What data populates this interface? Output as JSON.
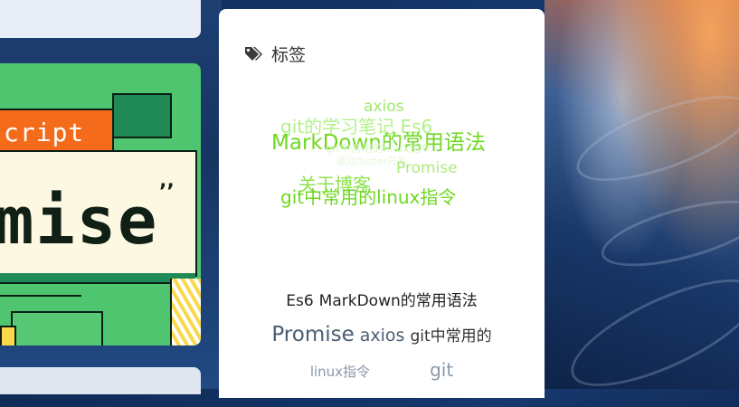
{
  "thumbnail": {
    "badge_text": "cript",
    "title_text": "mise",
    "title_mark": "’’"
  },
  "tag_panel": {
    "title": "标签",
    "icon": "tags-icon",
    "cloud_words": [
      {
        "text": "axios",
        "color": "#9ee86b"
      },
      {
        "text": "git的学习笔记 Es6",
        "color": "#b4f08a"
      },
      {
        "text": "MarkDown的常用语法",
        "color": "#6ed81f"
      },
      {
        "text": "git中常用的linux指令",
        "color": "#dff6cf"
      },
      {
        "text": "驱动flutter开发",
        "color": "#e6f7da"
      },
      {
        "text": "Promise",
        "color": "#a9ec7d"
      },
      {
        "text": "关于博客",
        "color": "#8ee24f"
      },
      {
        "text": "git中常用的linux指令",
        "color": "#6ed81f"
      }
    ],
    "tag_rows": [
      [
        {
          "text": "Es6",
          "color": "#222222"
        },
        {
          "text": "MarkDown的常用语法",
          "color": "#222222"
        }
      ],
      [
        {
          "text": "Promise",
          "color": "#4a5d73"
        },
        {
          "text": "axios",
          "color": "#4a5d73"
        },
        {
          "text": "git中常用的",
          "color": "#333333"
        }
      ],
      [
        {
          "text": "linux指令",
          "color": "#8a98a8"
        },
        {
          "text": "git",
          "color": "#8a98a8"
        }
      ]
    ]
  }
}
